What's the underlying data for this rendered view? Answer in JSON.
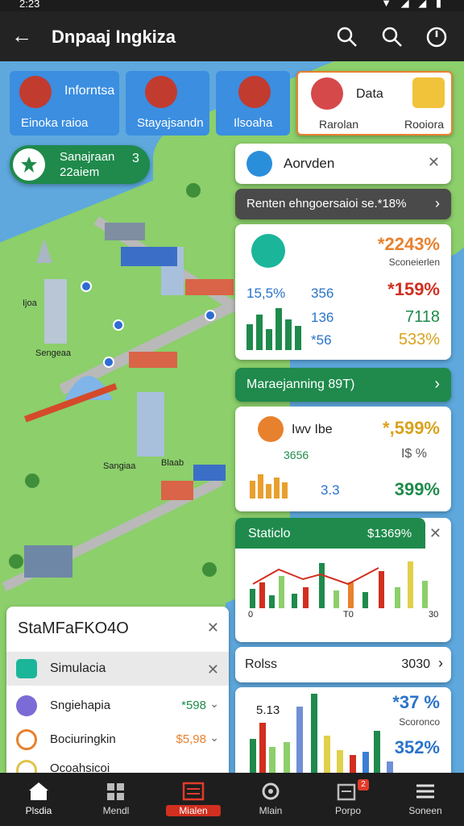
{
  "status": {
    "time": "2:23",
    "icons": "▼ ◢ ◢ ▮"
  },
  "appbar": {
    "title": "Dnpaaj Ingkiza",
    "back": "←"
  },
  "tiles": [
    {
      "title": "Inforntsa",
      "label": "Einoka raioa"
    },
    {
      "label": "Stayajsandn"
    },
    {
      "label": "Ilsoaha"
    },
    {
      "title": "Data",
      "label_left": "Rarolan",
      "label_right": "Rooiora"
    }
  ],
  "badge": {
    "line1": "Sanajraan",
    "line2": "22aiem",
    "count": "3"
  },
  "map_labels": {
    "a": "Sengeaa",
    "b": "Sangiaa",
    "c": "Blaab",
    "d": "Ijoa"
  },
  "panel1": {
    "title": "Aorvden"
  },
  "panel2": {
    "title": "Renten ehngoersaioi se.*18%"
  },
  "stats1": {
    "pct1": "*2243%",
    "sub1": "Sconeierlen",
    "a": "15,5%",
    "b": "356",
    "c": "136",
    "d": "*56",
    "pct2": "*159%",
    "pct3": "7118",
    "pct4": "533%"
  },
  "panel3": {
    "title": "Maraejanning 89T)"
  },
  "stats2": {
    "label": "Iwv Ibe",
    "pct1": "*,599%",
    "v1": "3656",
    "v2": "I$ %",
    "v3": "3.3",
    "pct2": "399%"
  },
  "panel4": {
    "title": "Staticlo",
    "value": "$1369%",
    "axis": [
      "0",
      "T0",
      "30"
    ]
  },
  "left_panel": {
    "title": "StaMFaFKO4O",
    "items": [
      {
        "label": "Simulacia",
        "value": ""
      },
      {
        "label": "Sngiehapia",
        "value": "*598"
      },
      {
        "label": "Bociuringkin",
        "value": "$5,98"
      },
      {
        "label": "Ocoahsicoi",
        "value": ""
      }
    ]
  },
  "panel5": {
    "title": "Rolss",
    "value": "3030",
    "v1": "5.13",
    "pct1": "*37 %",
    "sub": "Scoronco",
    "pct2": "352%"
  },
  "nav": [
    {
      "label": "Plsdia"
    },
    {
      "label": "Mendl"
    },
    {
      "label": "Mialen"
    },
    {
      "label": "Mlain"
    },
    {
      "label": "Porpo",
      "badge": "2"
    },
    {
      "label": "Soneen"
    }
  ],
  "colors": {
    "green": "#1f8a4c",
    "orange": "#e8812d",
    "red": "#d12f1f",
    "blue": "#3a7fd5",
    "map_water": "#5ea8dd"
  }
}
